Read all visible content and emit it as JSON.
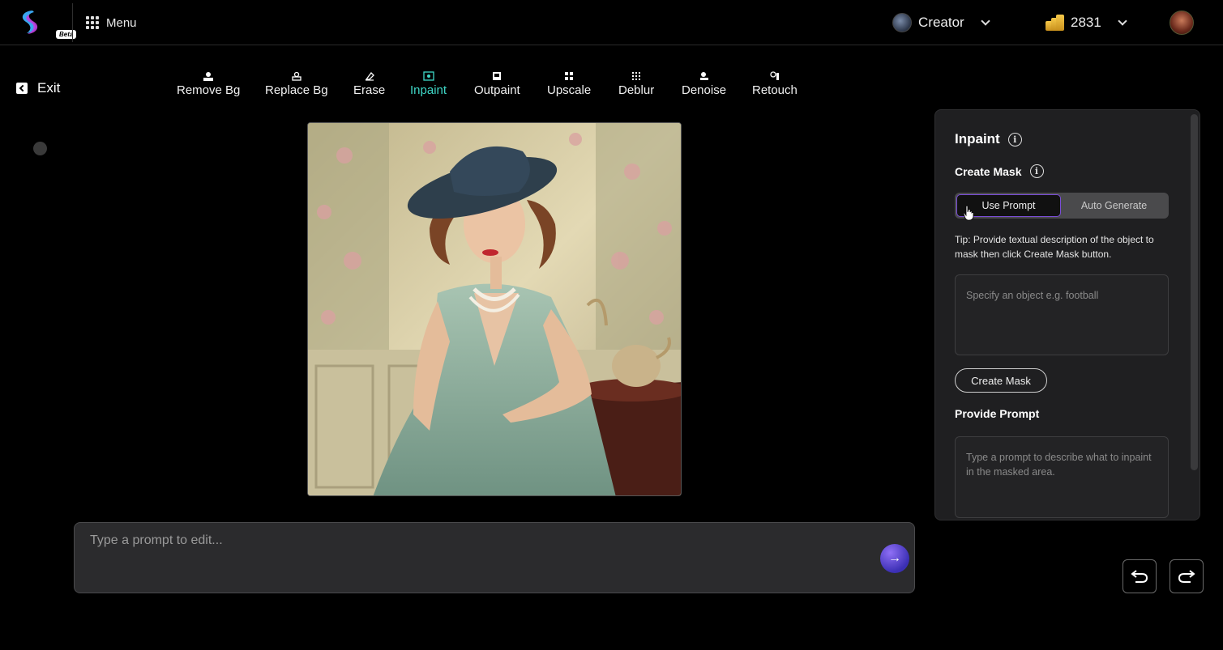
{
  "header": {
    "logo_badge": "Beta",
    "menu_label": "Menu",
    "plan_label": "Creator",
    "credits": "2831"
  },
  "nav": {
    "exit_label": "Exit"
  },
  "tools": [
    {
      "label": "Remove Bg",
      "icon": "remove-bg-icon"
    },
    {
      "label": "Replace Bg",
      "icon": "replace-bg-icon"
    },
    {
      "label": "Erase",
      "icon": "eraser-icon"
    },
    {
      "label": "Inpaint",
      "icon": "inpaint-icon"
    },
    {
      "label": "Outpaint",
      "icon": "outpaint-icon"
    },
    {
      "label": "Upscale",
      "icon": "upscale-icon"
    },
    {
      "label": "Deblur",
      "icon": "deblur-icon"
    },
    {
      "label": "Denoise",
      "icon": "denoise-icon"
    },
    {
      "label": "Retouch",
      "icon": "retouch-icon"
    }
  ],
  "active_tool": "Inpaint",
  "editor": {
    "prompt_placeholder": "Type a prompt to edit...",
    "prompt_value": ""
  },
  "panel": {
    "title": "Inpaint",
    "create_mask_heading": "Create Mask",
    "toggle": {
      "use_prompt": "Use Prompt",
      "auto_generate": "Auto Generate",
      "selected": "Use Prompt"
    },
    "tip": "Tip: Provide textual description of the object to mask then click Create Mask button.",
    "mask_placeholder": "Specify an object e.g. football",
    "create_mask_button": "Create Mask",
    "provide_prompt_heading": "Provide Prompt",
    "inpaint_placeholder": "Type a prompt to describe what to inpaint in the masked area."
  },
  "colors": {
    "accent": "#3fd7c7",
    "toggle_border": "#7a4dd8",
    "send_button": "#5b45d8"
  }
}
